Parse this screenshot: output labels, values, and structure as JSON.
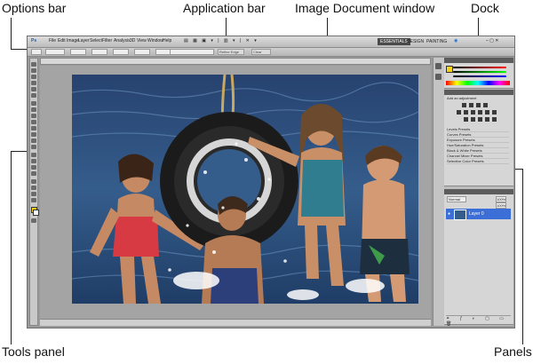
{
  "callouts": {
    "options_bar": "Options bar",
    "application_bar": "Application bar",
    "image_document_window": "Image Document window",
    "dock": "Dock",
    "tools_panel": "Tools panel",
    "panels": "Panels"
  },
  "app": {
    "menu": [
      "File",
      "Edit",
      "Image",
      "Layer",
      "Select",
      "Filter",
      "Analysis",
      "3D",
      "View",
      "Window",
      "Help"
    ],
    "workspaces": [
      "ESSENTIALS",
      "DESIGN",
      "PAINTING"
    ],
    "options_button_1": "Refine Edge",
    "options_button_2": "Clear"
  },
  "adjustments": {
    "title": "Add an adjustment",
    "presets": [
      "Levels Presets",
      "Curves Presets",
      "Exposure Presets",
      "Hue/Saturation Presets",
      "Black & White Presets",
      "Channel Mixer Presets",
      "Selective Color Presets"
    ]
  },
  "layers": {
    "blend_mode": "Normal",
    "opacity": "100%",
    "fill": "100%",
    "layer_name": "Layer 0"
  },
  "colors": {
    "app_bar": "#c8c8c8",
    "canvas_bg": "#a4a4a4",
    "selected_layer": "#3c6ed8",
    "workspace_active": "#4a4a4a"
  }
}
